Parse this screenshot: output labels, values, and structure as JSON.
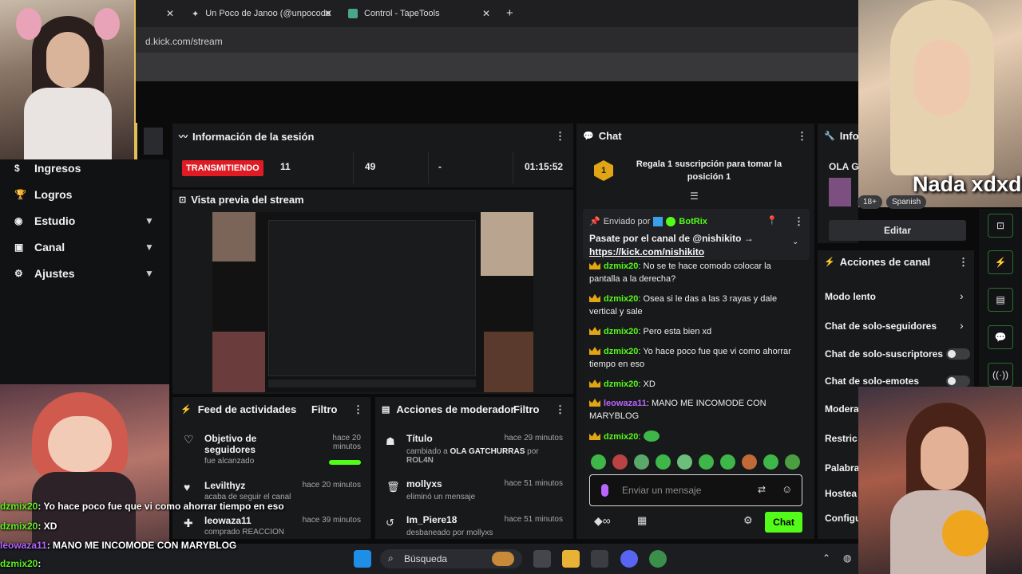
{
  "browser": {
    "tabs": [
      {
        "label": "Un Poco de Janoo (@unpocode"
      },
      {
        "label": "Control - TapeTools"
      }
    ],
    "new_tab": "+",
    "url": "d.kick.com/stream"
  },
  "sidebar": {
    "items": [
      {
        "label": "Ingresos",
        "icon": "dollar-icon"
      },
      {
        "label": "Logros",
        "icon": "trophy-icon"
      },
      {
        "label": "Estudio",
        "icon": "studio-icon"
      },
      {
        "label": "Canal",
        "icon": "channel-icon"
      },
      {
        "label": "Ajustes",
        "icon": "gear-icon"
      }
    ]
  },
  "session": {
    "title": "Información de la sesión",
    "status": "TRANSMITIENDO",
    "stat1": "11",
    "stat2": "49",
    "stat3": "-",
    "duration": "01:15:52"
  },
  "preview": {
    "title": "Vista previa del stream"
  },
  "activity": {
    "title": "Feed de actividades",
    "filter": "Filtro",
    "items": [
      {
        "title": "Objetivo de seguidores",
        "sub": "fue alcanzado",
        "time": "hace 20 minutos"
      },
      {
        "title": "Levilthyz",
        "sub": "acaba de seguir el canal",
        "time": "hace 20 minutos"
      },
      {
        "title": "leowaza11",
        "sub": "comprado REACCION",
        "time": "hace 39 minutos"
      }
    ]
  },
  "mod_actions": {
    "title": "Acciones de moderador",
    "filter": "Filtro",
    "items": [
      {
        "title": "Título",
        "sub_prefix": "cambiado a",
        "sub_value": "OLA GATCHURRAS",
        "sub_by": "por",
        "user": "ROL4N",
        "time": "hace 29 minutos"
      },
      {
        "title": "mollyxs",
        "sub": "eliminó un mensaje",
        "time": "hace 51 minutos"
      },
      {
        "title": "Im_Piere18",
        "sub": "desbaneado por mollyxs",
        "time": "hace 51 minutos"
      }
    ]
  },
  "chat": {
    "title": "Chat",
    "gift_text": "Regala 1 suscripción para tomar la posición 1",
    "gift_rank": "1",
    "pinned_prefix": "Enviado por",
    "pinned_user": "BotRix",
    "pinned_text": "Pasate por el canal de @nishikito →",
    "pinned_link": "https://kick.com/nishikito",
    "messages": [
      {
        "user": "dzmix20",
        "text": "No se te hace comodo colocar la pantalla a la derecha?"
      },
      {
        "user": "dzmix20",
        "text": "Osea si le das a las 3 rayas y dale vertical y sale"
      },
      {
        "user": "dzmix20",
        "text": "Pero esta bien xd"
      },
      {
        "user": "dzmix20",
        "text": "Yo hace poco fue que vi como ahorrar tiempo en eso"
      },
      {
        "user": "dzmix20",
        "text": "XD"
      },
      {
        "user": "leowaza11",
        "text": "MANO ME INCOMODE CON MARYBLOG"
      },
      {
        "user": "dzmix20",
        "text": ""
      }
    ],
    "input_placeholder": "Enviar un mensaje",
    "send_label": "Chat"
  },
  "info": {
    "title": "Info",
    "stream_title": "OLA G",
    "age_badge": "18+",
    "language": "Spanish",
    "edit_label": "Editar"
  },
  "channel_actions": {
    "title": "Acciones de canal",
    "items": [
      {
        "label": "Modo lento",
        "control": "chevron"
      },
      {
        "label": "Chat de solo-seguidores",
        "control": "chevron"
      },
      {
        "label": "Chat de solo-suscriptores",
        "control": "toggle",
        "on": false
      },
      {
        "label": "Chat de solo-emotes",
        "control": "toggle",
        "on": false
      },
      {
        "label": "Modera",
        "control": "none"
      },
      {
        "label": "Restric",
        "control": "none"
      },
      {
        "label": "Palabra",
        "control": "none"
      },
      {
        "label": "Hostea",
        "control": "none"
      },
      {
        "label": "Configu",
        "control": "none"
      }
    ]
  },
  "cam_caption": "Nada xdxd",
  "overlay_chat": [
    {
      "user": "dzmix20",
      "text": ": Yo hace poco fue que vi como ahorrar tiempo en eso"
    },
    {
      "user": "dzmix20",
      "text": ": XD"
    },
    {
      "user": "leowaza11",
      "text": ": MANO ME INCOMODE CON MARYBLOG"
    },
    {
      "user": "dzmix20",
      "text": ":"
    }
  ],
  "taskbar": {
    "search_label": "Búsqueda"
  },
  "colors": {
    "accent": "#53fc18",
    "live": "#e01b24",
    "panel": "#18191b"
  }
}
